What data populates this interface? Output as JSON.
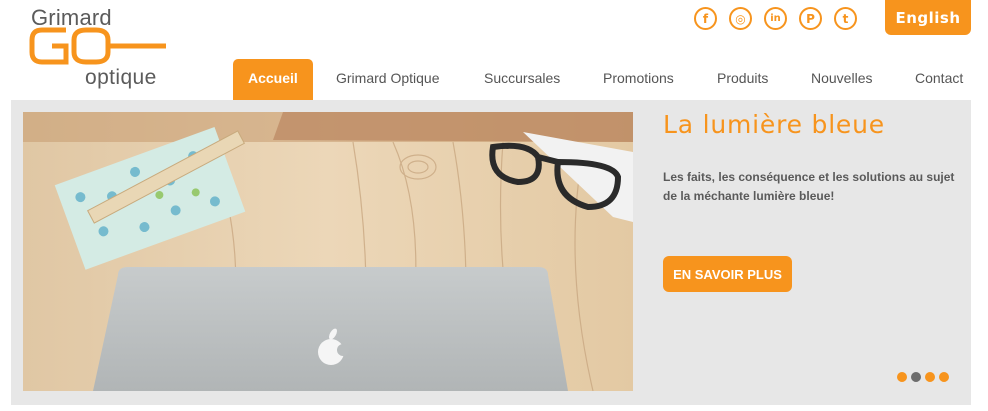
{
  "logo": {
    "top": "Grimard",
    "mark": "GO",
    "bottom": "optique"
  },
  "social": [
    {
      "name": "facebook",
      "glyph": "f"
    },
    {
      "name": "instagram",
      "glyph": "◎"
    },
    {
      "name": "linkedin",
      "glyph": "in"
    },
    {
      "name": "pinterest",
      "glyph": "P"
    },
    {
      "name": "twitter",
      "glyph": "t"
    }
  ],
  "language_button": "English",
  "nav": {
    "items": [
      "Accueil",
      "Grimard Optique",
      "Succursales",
      "Promotions",
      "Produits",
      "Nouvelles",
      "Contact"
    ],
    "active_index": 0
  },
  "slide": {
    "title": "La lumière bleue",
    "text": "Les faits, les conséquence et les solutions au sujet de la méchante lumière bleue!",
    "cta": "EN SAVOIR PLUS"
  },
  "slider_dots": {
    "count": 4,
    "active_index": 1
  },
  "colors": {
    "accent": "#f7941d",
    "panel": "#e7e7e7",
    "text": "#555555"
  }
}
